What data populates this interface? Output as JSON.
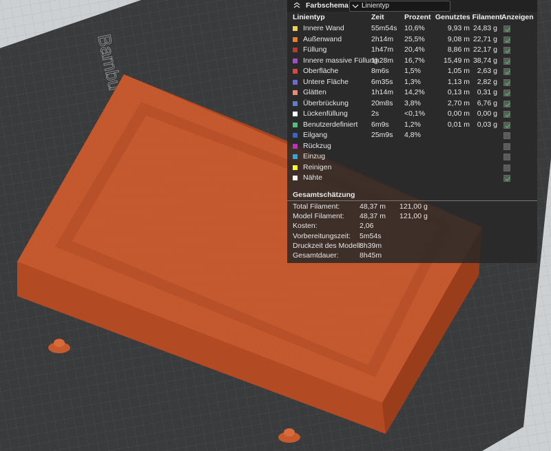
{
  "bed": {
    "label": "Bambu Smooth PEI Plate / High T"
  },
  "panel": {
    "title": "Farbschema",
    "selector_value": "Linientyp",
    "columns": [
      "Linientyp",
      "Zeit",
      "Prozent",
      "Genutztes Filament",
      "Anzeigen"
    ],
    "rows": [
      {
        "name": "Innere Wand",
        "time": "55m54s",
        "pct": "10,6%",
        "len": "9,93 m",
        "wt": "24,83 g",
        "color": "#f2d24a",
        "show": true
      },
      {
        "name": "Außenwand",
        "time": "2h14m",
        "pct": "25,5%",
        "len": "9,08 m",
        "wt": "22,71 g",
        "color": "#f07b2d",
        "show": true
      },
      {
        "name": "Füllung",
        "time": "1h47m",
        "pct": "20,4%",
        "len": "8,86 m",
        "wt": "22,17 g",
        "color": "#b83a2c",
        "show": true
      },
      {
        "name": "Innere massive Füllung",
        "time": "1h28m",
        "pct": "16,7%",
        "len": "15,49 m",
        "wt": "38,74 g",
        "color": "#a64ad1",
        "show": true
      },
      {
        "name": "Oberfläche",
        "time": "8m6s",
        "pct": "1,5%",
        "len": "1,05 m",
        "wt": "2,63 g",
        "color": "#e0443c",
        "show": true
      },
      {
        "name": "Untere Fläche",
        "time": "6m35s",
        "pct": "1,3%",
        "len": "1,13 m",
        "wt": "2,82 g",
        "color": "#6b6bd6",
        "show": true
      },
      {
        "name": "Glätten",
        "time": "1h14m",
        "pct": "14,2%",
        "len": "0,13 m",
        "wt": "0,31 g",
        "color": "#f08a6a",
        "show": true
      },
      {
        "name": "Überbrückung",
        "time": "20m8s",
        "pct": "3,8%",
        "len": "2,70 m",
        "wt": "6,76 g",
        "color": "#5b82c8",
        "show": true
      },
      {
        "name": "Lückenfüllung",
        "time": "2s",
        "pct": "<0,1%",
        "len": "0,00 m",
        "wt": "0,00 g",
        "color": "#ffffff",
        "show": true
      },
      {
        "name": "Benutzerdefiniert",
        "time": "6m9s",
        "pct": "1,2%",
        "len": "0,01 m",
        "wt": "0,03 g",
        "color": "#4fc07a",
        "show": true
      },
      {
        "name": "Eilgang",
        "time": "25m9s",
        "pct": "4,8%",
        "len": "",
        "wt": "",
        "color": "#3a63c8",
        "show": false
      },
      {
        "name": "Rückzug",
        "time": "",
        "pct": "",
        "len": "",
        "wt": "",
        "color": "#c030c0",
        "show": false
      },
      {
        "name": "Einzug",
        "time": "",
        "pct": "",
        "len": "",
        "wt": "",
        "color": "#32a8d8",
        "show": false
      },
      {
        "name": "Reinigen",
        "time": "",
        "pct": "",
        "len": "",
        "wt": "",
        "color": "#ffff20",
        "show": false
      },
      {
        "name": "Nähte",
        "time": "",
        "pct": "",
        "len": "",
        "wt": "",
        "color": "#f4f4f4",
        "show": true
      }
    ],
    "summary_title": "Gesamtschätzung",
    "summary": [
      {
        "k": "Total Filament:",
        "v1": "48,37 m",
        "v2": "121,00 g"
      },
      {
        "k": "Model Filament:",
        "v1": "48,37 m",
        "v2": "121,00 g"
      },
      {
        "k": "Kosten:",
        "v1": "2,06",
        "v2": ""
      },
      {
        "k": "Vorbereitungszeit:",
        "v1": "5m54s",
        "v2": ""
      },
      {
        "k": "Druckzeit des Modell:",
        "v1": "8h39m",
        "v2": ""
      },
      {
        "k": "Gesamtdauer:",
        "v1": "8h45m",
        "v2": ""
      }
    ]
  },
  "colors": {
    "accent_check": "#3fb34f",
    "model": "#c8582e"
  }
}
